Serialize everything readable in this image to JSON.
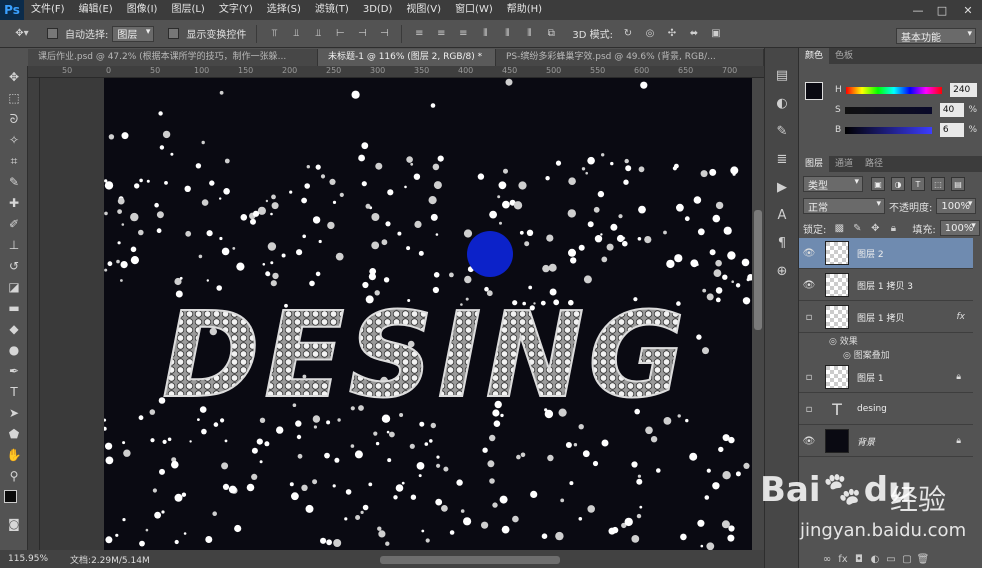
{
  "menubar": {
    "logo": "Ps",
    "items": [
      "文件(F)",
      "编辑(E)",
      "图像(I)",
      "图层(L)",
      "文字(Y)",
      "选择(S)",
      "滤镜(T)",
      "3D(D)",
      "视图(V)",
      "窗口(W)",
      "帮助(H)"
    ],
    "controls": [
      "—",
      "□",
      "✕"
    ]
  },
  "options": {
    "auto_select_label": "自动选择:",
    "auto_select_value": "图层",
    "transform_label": "显示变换控件",
    "mode3d_label": "3D 模式:",
    "workspace": "基本功能"
  },
  "tabs": [
    {
      "label": "课后作业.psd @ 47.2% (根据本课所学的技巧，制作一张躲..."
    },
    {
      "label": "未标题-1 @ 116% (图层 2, RGB/8) *"
    },
    {
      "label": "PS-缤纷多彩蜂巢字效.psd @ 49.6% (背景, RGB/..."
    }
  ],
  "ruler": {
    "labels": [
      "50",
      "0",
      "50",
      "100",
      "150",
      "200",
      "250",
      "300",
      "350",
      "400",
      "450",
      "500",
      "550",
      "600",
      "650",
      "700"
    ]
  },
  "canvas": {
    "text": "DESING"
  },
  "status": {
    "zoom": "115.95%",
    "doc": "文档:2.29M/5.14M"
  },
  "color_panel": {
    "tabs": [
      "颜色",
      "色板"
    ],
    "h_label": "H",
    "h_value": "240",
    "s_label": "S",
    "s_value": "40",
    "b_label": "B",
    "b_value": "6",
    "pct": "%",
    "h_fraction": 0.67,
    "s_fraction": 0.4,
    "b_fraction": 0.06
  },
  "layers_panel": {
    "tabs": [
      "图层",
      "通道",
      "路径"
    ],
    "filter": "类型",
    "blend_mode": "正常",
    "opacity_label": "不透明度:",
    "opacity_value": "100%",
    "lock_label": "锁定:",
    "fill_label": "填充:",
    "fill_value": "100%",
    "layers": [
      {
        "name": "图层 2",
        "visible": true,
        "selected": true
      },
      {
        "name": "图层 1 拷贝 3",
        "visible": true
      },
      {
        "name": "图层 1 拷贝",
        "visible": false,
        "fx": "fx"
      },
      {
        "name": "图层 1",
        "visible": false,
        "locked": true
      },
      {
        "name": "desing",
        "visible": false,
        "text_layer": true
      },
      {
        "name": "背景",
        "visible": true,
        "locked": true
      }
    ],
    "effects_label": "效果",
    "effect_item": "图案叠加"
  },
  "watermark": {
    "brand": "Bai",
    "brand2": "du",
    "cn": "经验",
    "url": "jingyan.baidu.com"
  }
}
